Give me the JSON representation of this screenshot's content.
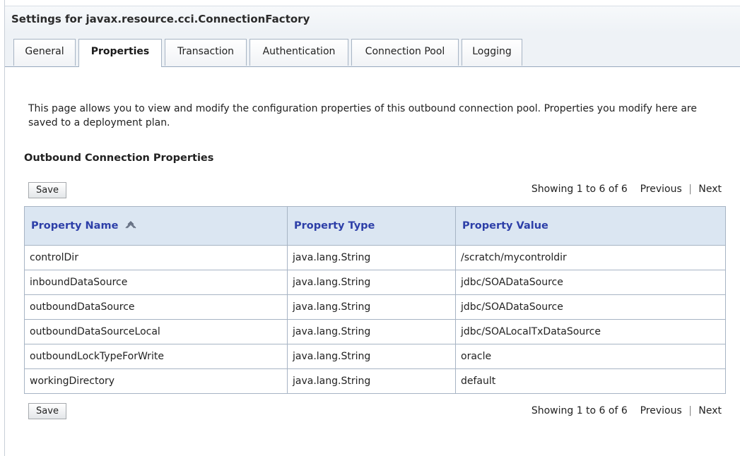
{
  "header": {
    "title": "Settings for javax.resource.cci.ConnectionFactory"
  },
  "tabs": [
    {
      "label": "General"
    },
    {
      "label": "Properties"
    },
    {
      "label": "Transaction"
    },
    {
      "label": "Authentication"
    },
    {
      "label": "Connection Pool"
    },
    {
      "label": "Logging"
    }
  ],
  "active_tab": "Properties",
  "description": "This page allows you to view and modify the configuration properties of this outbound connection pool. Properties you modify here are saved to a deployment plan.",
  "section": {
    "title": "Outbound Connection Properties"
  },
  "toolbar": {
    "save_label": "Save",
    "showing": "Showing 1 to 6 of 6",
    "previous": "Previous",
    "separator": "|",
    "next": "Next"
  },
  "table": {
    "columns": [
      "Property Name",
      "Property Type",
      "Property Value"
    ],
    "sort_icon": "sort-ascending-icon",
    "rows": [
      {
        "name": "controlDir",
        "type": "java.lang.String",
        "value": "/scratch/mycontroldir"
      },
      {
        "name": "inboundDataSource",
        "type": "java.lang.String",
        "value": "jdbc/SOADataSource"
      },
      {
        "name": "outboundDataSource",
        "type": "java.lang.String",
        "value": "jdbc/SOADataSource"
      },
      {
        "name": "outboundDataSourceLocal",
        "type": "java.lang.String",
        "value": "jdbc/SOALocalTxDataSource"
      },
      {
        "name": "outboundLockTypeForWrite",
        "type": "java.lang.String",
        "value": "oracle"
      },
      {
        "name": "workingDirectory",
        "type": "java.lang.String",
        "value": "default"
      }
    ]
  },
  "colors": {
    "header_link": "#2d3fa8",
    "table_header_bg": "#dbe6f2",
    "border": "#a7b4c4"
  }
}
